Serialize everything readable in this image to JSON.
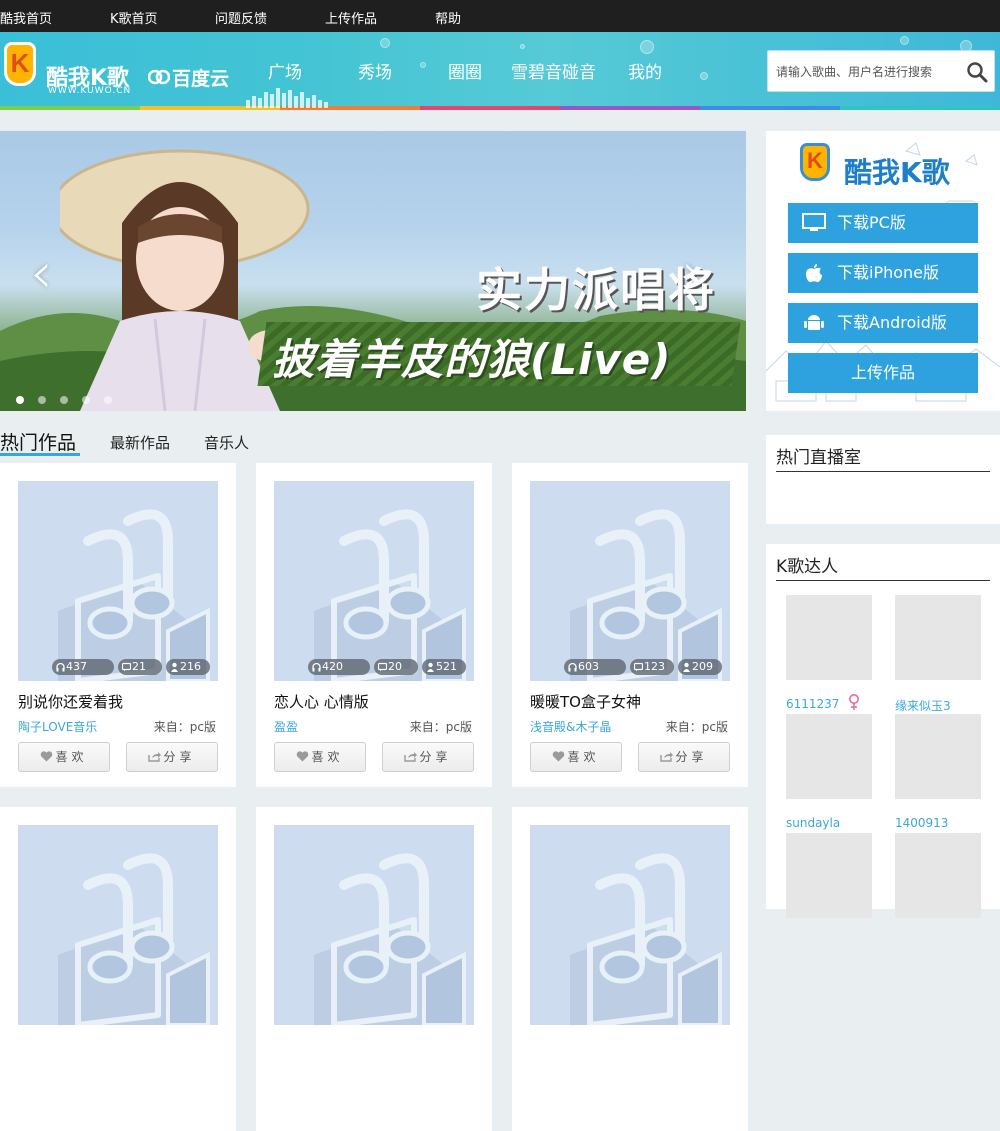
{
  "topbar": {
    "links": [
      "酷我首页",
      "K歌首页",
      "问题反馈",
      "上传作品",
      "帮助"
    ]
  },
  "header": {
    "logo_text": "酷我K歌",
    "logo_k": "K",
    "logo_url": "WWW.KUWO.CN",
    "partner": "百度云",
    "nav": [
      "广场",
      "秀场",
      "圈圈",
      "雪碧音碰音",
      "我的"
    ],
    "search_placeholder": "请输入歌曲、用户名进行搜索"
  },
  "banner": {
    "title_line1": "实力派唱将",
    "title_line2": "披着羊皮的狼(Live)",
    "slide_count": 5,
    "active_slide": 0
  },
  "tabs": [
    "热门作品",
    "最新作品",
    "音乐人"
  ],
  "cards": [
    {
      "listens": "437",
      "comments": "21",
      "gifts": "216",
      "title": "别说你还爱着我",
      "author": "陶子LOVE音乐",
      "from": "来自：pc版"
    },
    {
      "listens": "420",
      "comments": "20",
      "gifts": "521",
      "title": "恋人心 心情版",
      "author": "盈盈",
      "from": "来自：pc版"
    },
    {
      "listens": "603",
      "comments": "123",
      "gifts": "209",
      "title": "暖暖TO盒子女神",
      "author": "浅音殿&木子晶",
      "from": "来自：pc版"
    }
  ],
  "card_buttons": {
    "like": "喜欢",
    "share": "分享"
  },
  "promo": {
    "logo_text": "酷我K歌",
    "logo_k": "K",
    "buttons": [
      "下载PC版",
      "下载iPhone版",
      "下载Android版",
      "上传作品"
    ]
  },
  "live_panel": {
    "title": "热门直播室"
  },
  "stars_panel": {
    "title": "K歌达人",
    "users": [
      "6111237",
      "缘来似玉3",
      "sundayla",
      "1400913"
    ],
    "first_user_gender_icon": "female-icon"
  },
  "colors": {
    "accent": "#2ea2df",
    "link": "#3ba7dc",
    "topbar": "#1f1f1f"
  }
}
